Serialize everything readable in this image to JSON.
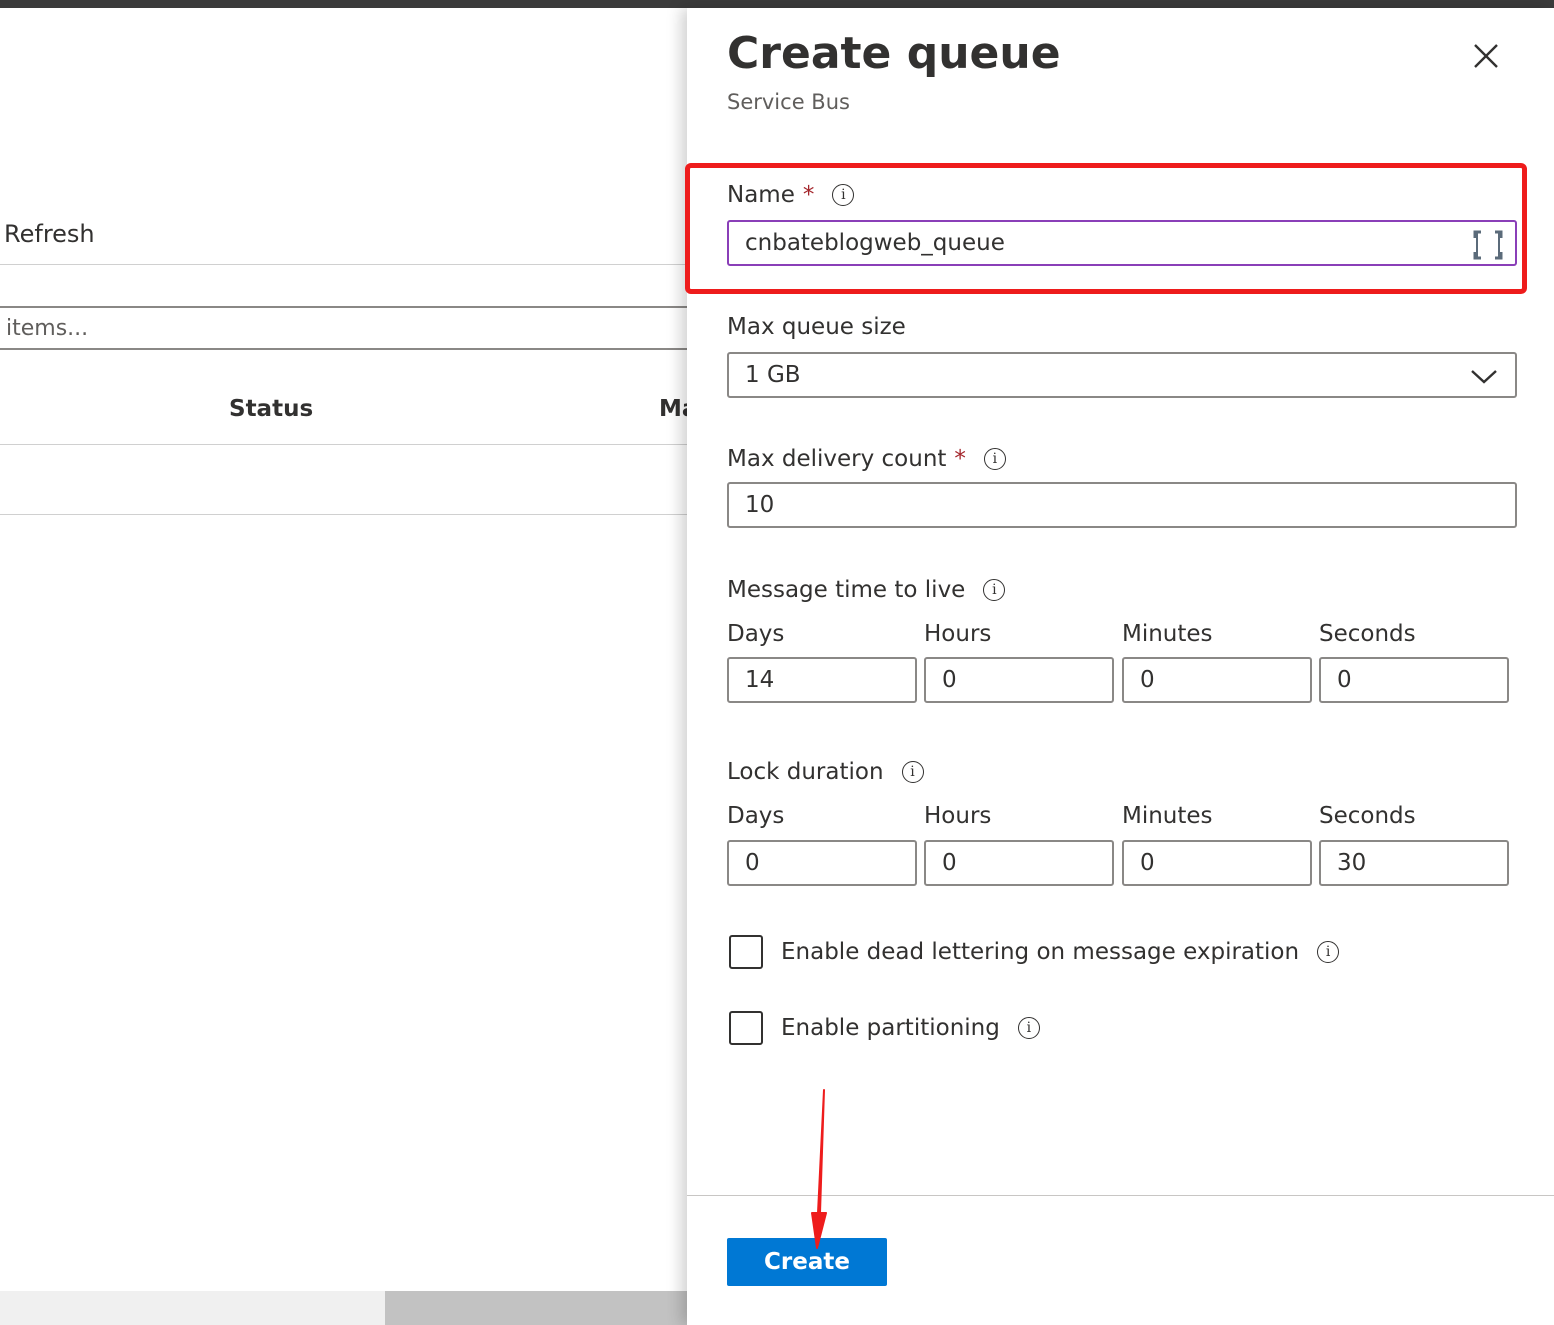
{
  "background": {
    "refresh_label": "Refresh",
    "filter_placeholder": "items...",
    "columns": [
      "Status",
      "Ma"
    ]
  },
  "panel": {
    "title": "Create queue",
    "subtitle": "Service Bus",
    "name": {
      "label": "Name",
      "required_mark": "*",
      "value": "cnbateblogweb_queue"
    },
    "max_queue_size": {
      "label": "Max queue size",
      "selected": "1 GB"
    },
    "max_delivery_count": {
      "label": "Max delivery count",
      "required_mark": "*",
      "value": "10"
    },
    "message_ttl": {
      "label": "Message time to live",
      "fields": [
        {
          "label": "Days",
          "value": "14"
        },
        {
          "label": "Hours",
          "value": "0"
        },
        {
          "label": "Minutes",
          "value": "0"
        },
        {
          "label": "Seconds",
          "value": "0"
        }
      ]
    },
    "lock_duration": {
      "label": "Lock duration",
      "fields": [
        {
          "label": "Days",
          "value": "0"
        },
        {
          "label": "Hours",
          "value": "0"
        },
        {
          "label": "Minutes",
          "value": "0"
        },
        {
          "label": "Seconds",
          "value": "30"
        }
      ]
    },
    "dead_lettering": {
      "label": "Enable dead lettering on message expiration",
      "checked": false
    },
    "partitioning": {
      "label": "Enable partitioning",
      "checked": false
    },
    "create_label": "Create",
    "info_glyph": "i"
  },
  "colors": {
    "primary": "#0078d4",
    "annotation": "#ee1c1c",
    "focus_border": "#8a3fb8",
    "required": "#a4262c"
  }
}
